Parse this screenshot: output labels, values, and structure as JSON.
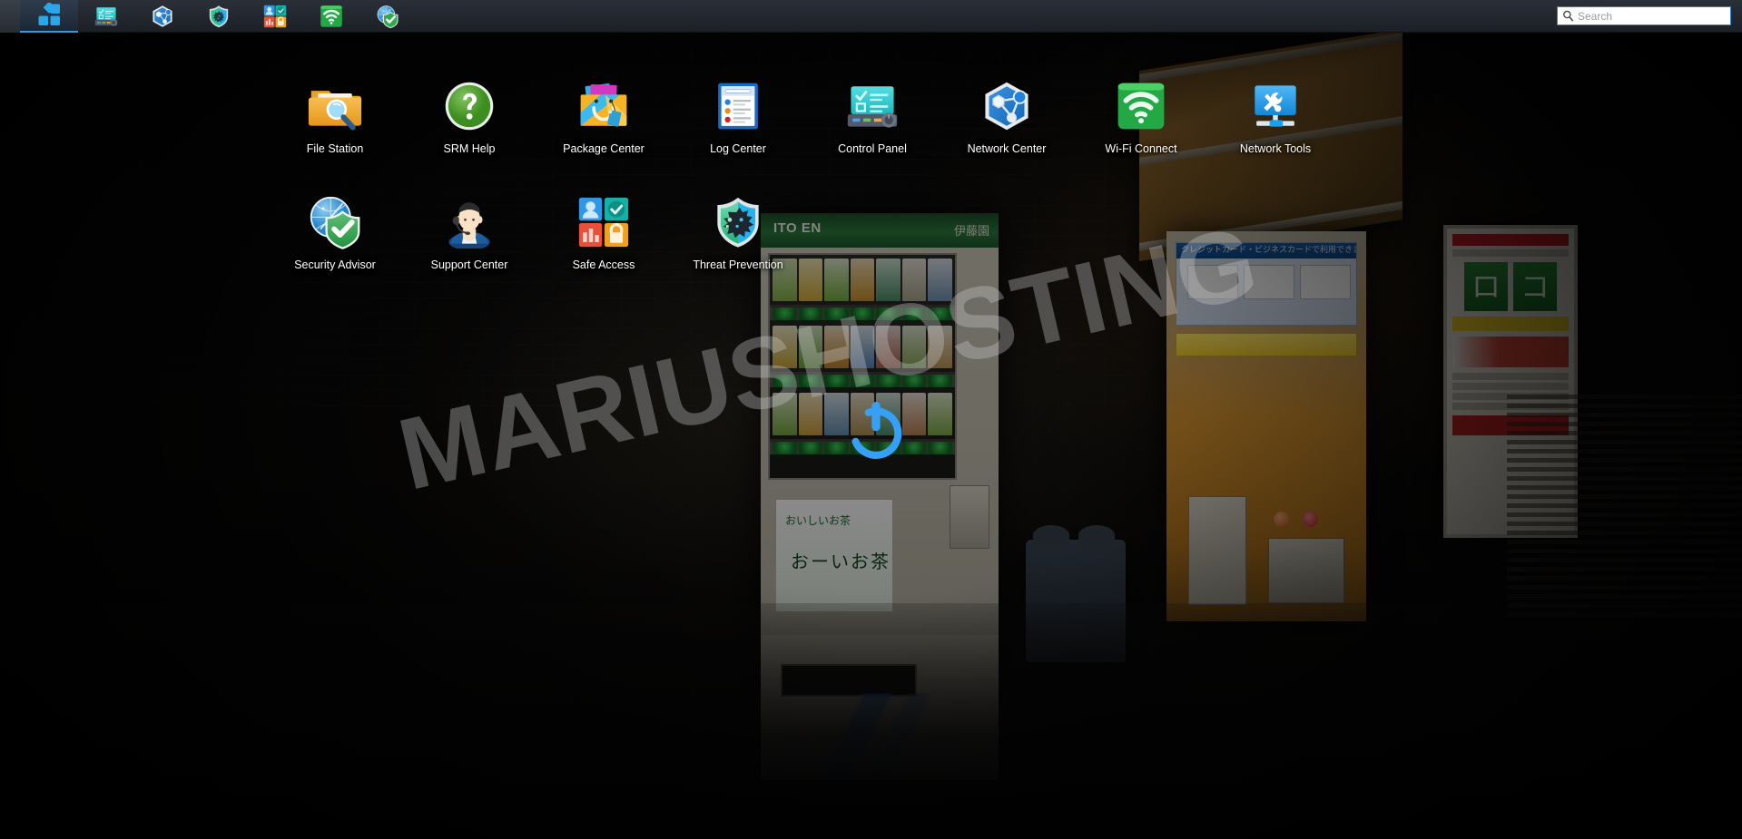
{
  "taskbar": {
    "menu_button": {
      "label": "Main Menu",
      "icon": "app-grid-icon"
    },
    "apps": [
      {
        "name": "Control Panel",
        "icon": "control-panel-icon"
      },
      {
        "name": "Network Center",
        "icon": "network-center-icon"
      },
      {
        "name": "Threat Prevention",
        "icon": "threat-prevention-icon"
      },
      {
        "name": "Safe Access",
        "icon": "safe-access-icon"
      },
      {
        "name": "Wi-Fi Connect",
        "icon": "wifi-connect-icon"
      },
      {
        "name": "Security Advisor",
        "icon": "security-advisor-icon"
      }
    ],
    "search": {
      "placeholder": "Search",
      "value": "",
      "icon": "search-icon"
    }
  },
  "desktop": {
    "watermark": "MARIUSHOSTING",
    "power_badge_icon": "power-icon",
    "rows": [
      [
        {
          "label": "File Station",
          "icon": "file-station-icon"
        },
        {
          "label": "SRM Help",
          "icon": "srm-help-icon"
        },
        {
          "label": "Package Center",
          "icon": "package-center-icon"
        },
        {
          "label": "Log Center",
          "icon": "log-center-icon"
        },
        {
          "label": "Control Panel",
          "icon": "control-panel-icon"
        },
        {
          "label": "Network Center",
          "icon": "network-center-icon"
        },
        {
          "label": "Wi-Fi Connect",
          "icon": "wifi-connect-icon"
        },
        {
          "label": "Network Tools",
          "icon": "network-tools-icon"
        }
      ],
      [
        {
          "label": "Security Advisor",
          "icon": "security-advisor-icon"
        },
        {
          "label": "Support Center",
          "icon": "support-center-icon"
        },
        {
          "label": "Safe Access",
          "icon": "safe-access-icon"
        },
        {
          "label": "Threat Prevention",
          "icon": "threat-prevention-icon"
        }
      ]
    ]
  },
  "background": {
    "vending_machine_brand": "ITO EN",
    "vending_machine_logo": "伊藤園",
    "vending_poster_line1": "おいしいお茶",
    "vending_poster_line2": "おーいお茶",
    "kiosk_header": "クレジットカード・ビジネスカードで利用できます",
    "sign_glyph_left": "ロ",
    "sign_glyph_right": "コ"
  },
  "colors": {
    "accent_blue": "#2f9ae6",
    "taskbar_bg": "#232830",
    "search_border": "#2f7fd0",
    "icon_label": "#ffffff",
    "power_blue": "#35a0f5",
    "watermark_gray": "#c8c8c8"
  }
}
